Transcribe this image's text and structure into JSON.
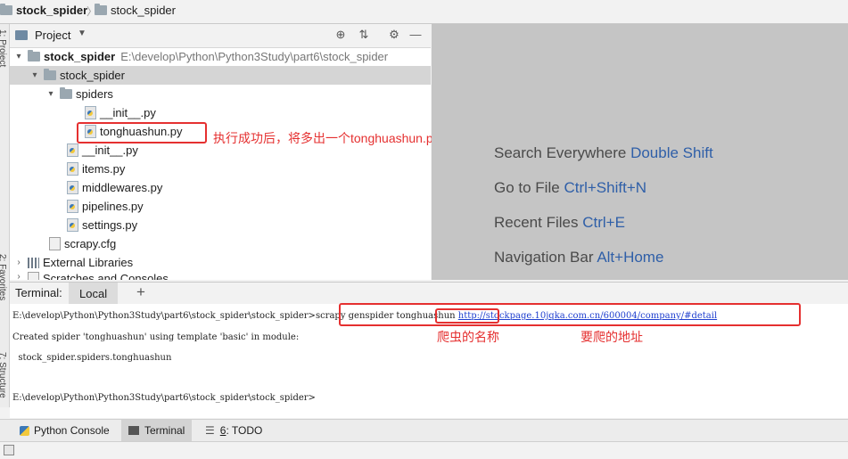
{
  "breadcrumb": {
    "items": [
      "stock_spider",
      "stock_spider"
    ]
  },
  "left_stripe": {
    "project_label": "1: Project",
    "favorites_label": "2: Favorites",
    "structure_label": "7: Structure"
  },
  "project_panel": {
    "title": "Project",
    "tree": [
      {
        "label": "stock_spider",
        "path": "E:\\develop\\Python\\Python3Study\\part6\\stock_spider",
        "type": "folder"
      },
      {
        "label": "stock_spider",
        "type": "folder"
      },
      {
        "label": "spiders",
        "type": "folder"
      },
      {
        "label": "__init__.py",
        "type": "py"
      },
      {
        "label": "tonghuashun.py",
        "type": "py"
      },
      {
        "label": "__init__.py",
        "type": "py"
      },
      {
        "label": "items.py",
        "type": "py"
      },
      {
        "label": "middlewares.py",
        "type": "py"
      },
      {
        "label": "pipelines.py",
        "type": "py"
      },
      {
        "label": "settings.py",
        "type": "py"
      },
      {
        "label": "scrapy.cfg",
        "type": "cfg"
      },
      {
        "label": "External Libraries",
        "type": "lib"
      },
      {
        "label": "Scratches and Consoles",
        "type": "scratch"
      }
    ]
  },
  "editor_hints": [
    {
      "text": "Search Everywhere",
      "key": "Double Shift"
    },
    {
      "text": "Go to File",
      "key": "Ctrl+Shift+N"
    },
    {
      "text": "Recent Files",
      "key": "Ctrl+E"
    },
    {
      "text": "Navigation Bar",
      "key": "Alt+Home"
    }
  ],
  "terminal": {
    "label": "Terminal:",
    "tab": "Local",
    "add": "+",
    "lines": {
      "prompt1": "E:\\develop\\Python\\Python3Study\\part6\\stock_spider\\stock_spider>",
      "cmd": "scrapy genspider ",
      "spider_name": "tonghuashun",
      "url": "http://stockpage.10jqka.com.cn/600004/company/#detail",
      "created": "Created spider 'tonghuashun' using template 'basic' in module:",
      "module": "  stock_spider.spiders.tonghuashun",
      "prompt2": "E:\\develop\\Python\\Python3Study\\part6\\stock_spider\\stock_spider>"
    }
  },
  "bottom_tabs": {
    "python_console": "Python Console",
    "terminal": "Terminal",
    "todo_num": "6",
    "todo_label": ": TODO"
  },
  "annotations": {
    "file_note": "执行成功后，将多出一个tonghuashun.py的文件",
    "name_note": "爬虫的名称",
    "url_note": "要爬的地址"
  },
  "colors": {
    "annotation": "#e53030",
    "link": "#1f3fcf",
    "hint_key": "#2f5fa8"
  }
}
